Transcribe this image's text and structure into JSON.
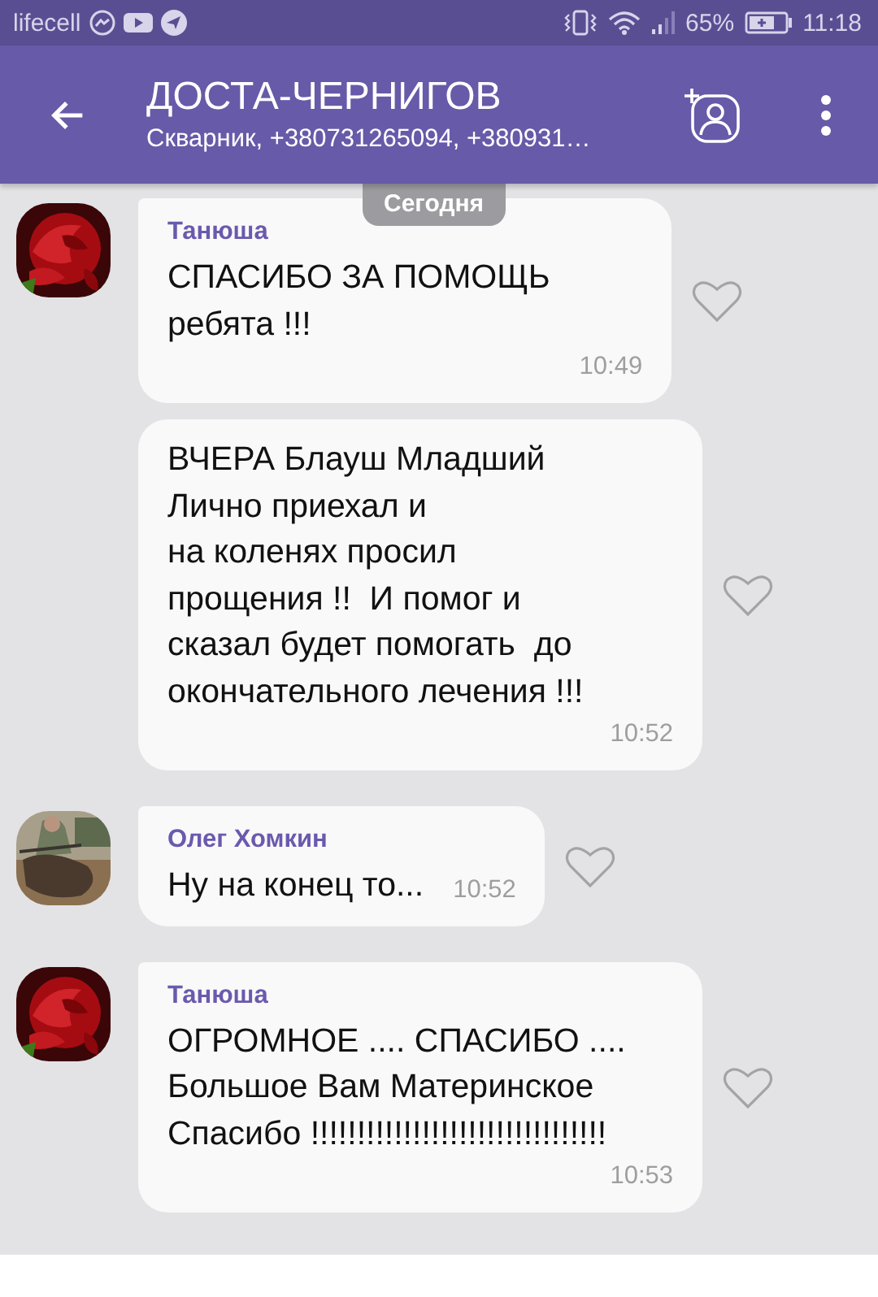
{
  "status_bar": {
    "carrier": "lifecell",
    "battery": "65%",
    "time": "11:18"
  },
  "header": {
    "title": "ДОСТА-ЧЕРНИГОВ",
    "subtitle": "Скварник, +380731265094, +380931…"
  },
  "date_label": "Сегодня",
  "messages": [
    {
      "sender": "Танюша",
      "text": "СПАСИБО ЗА ПОМОЩЬ\nребята !!!",
      "time": "10:49"
    },
    {
      "text": "ВЧЕРА Блауш Младший\nЛично приехал и\nна коленях просил\nпрощения !!  И помог и\nсказал будет помогать  до\nокончательного лечения !!!",
      "time": "10:52"
    },
    {
      "sender": "Олег Хомкин",
      "text": "Ну на конец то...",
      "time": "10:52"
    },
    {
      "sender": "Танюша",
      "text": "ОГРОМНОЕ .... СПАСИБО ....\nБольшое Вам Материнское\nСпасибо !!!!!!!!!!!!!!!!!!!!!!!!!!!!!!!!",
      "time": "10:53"
    }
  ]
}
